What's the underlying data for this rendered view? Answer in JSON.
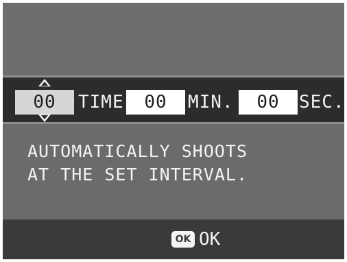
{
  "interval_setting": {
    "hours_value": "00",
    "hours_unit": "TIME",
    "minutes_value": "00",
    "minutes_unit": "MIN.",
    "seconds_value": "00",
    "seconds_unit": "SEC."
  },
  "message": {
    "line1": "AUTOMATICALLY SHOOTS",
    "line2": "AT THE SET INTERVAL."
  },
  "footer": {
    "ok_icon_text": "OK",
    "ok_label": "OK",
    "ok_icon": "ok-button-icon"
  },
  "colors": {
    "screen_bg": "#6b6b6b",
    "setting_row_bg": "#2c2c2c",
    "footer_bg": "#3a3a3a",
    "active_field_bg": "#d6d6d6",
    "field_bg": "#ffffff"
  }
}
